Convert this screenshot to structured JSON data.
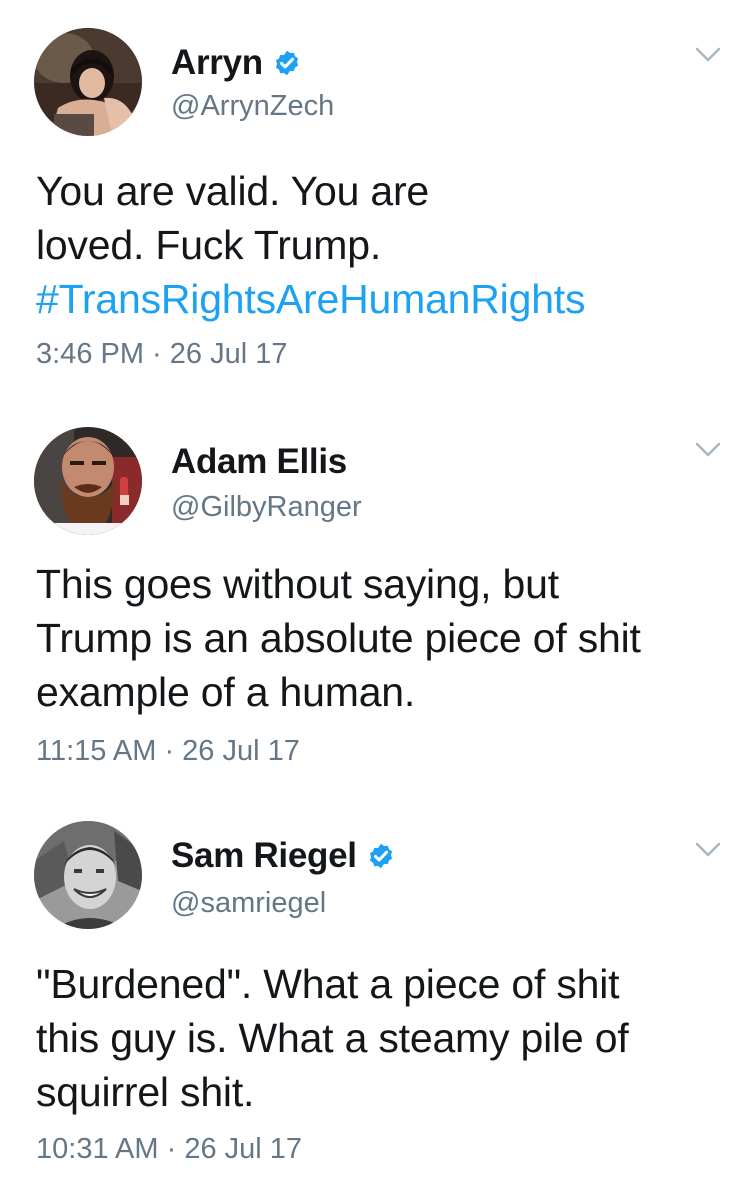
{
  "tweets": [
    {
      "display_name": "Arryn",
      "verified": true,
      "handle": "@ArrynZech",
      "text_lines": [
        "You are valid. You are",
        "loved. Fuck Trump."
      ],
      "hashtag": "#TransRightsAreHumanRights",
      "time": "3:46 PM",
      "date": "26 Jul 17"
    },
    {
      "display_name": "Adam Ellis",
      "verified": false,
      "handle": "@GilbyRanger",
      "text_lines": [
        "This goes without saying, but",
        "Trump is an absolute piece of shit",
        "example of a human."
      ],
      "time": "11:15 AM",
      "date": "26 Jul 17"
    },
    {
      "display_name": "Sam Riegel",
      "verified": true,
      "handle": "@samriegel",
      "text_lines": [
        "\"Burdened\". What a piece of shit",
        "this guy is. What a steamy pile of",
        "squirrel shit."
      ],
      "time": "10:31 AM",
      "date": "26 Jul 17"
    }
  ],
  "separator": " · ",
  "colors": {
    "text": "#14171a",
    "secondary": "#657786",
    "link": "#1da1f2",
    "verified_badge": "#1da1f2"
  },
  "icons": {
    "verified": "verified-badge-icon",
    "menu": "chevron-down-icon"
  }
}
